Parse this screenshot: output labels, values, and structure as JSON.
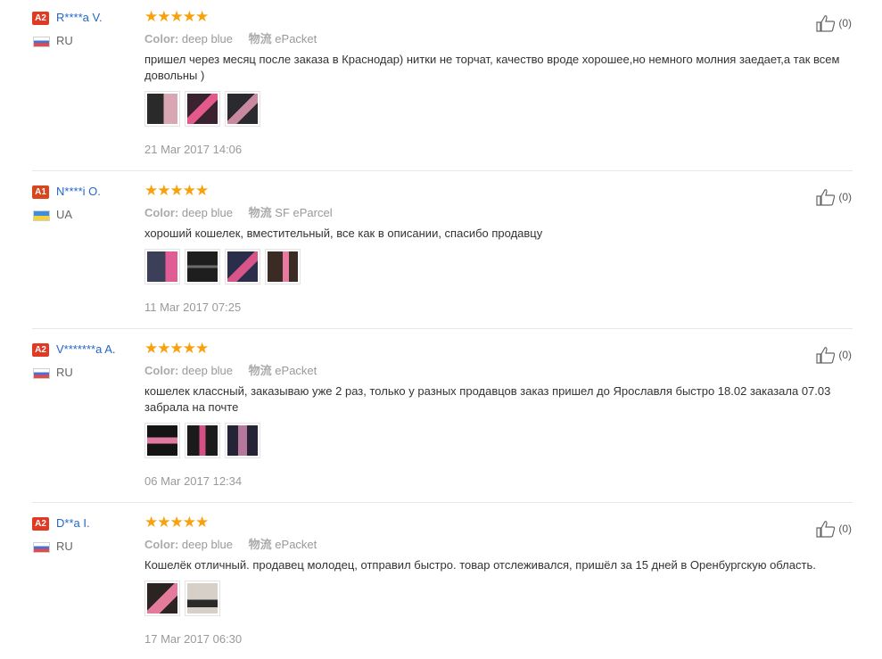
{
  "labels": {
    "color": "Color:",
    "shipping": "物流"
  },
  "reviews": [
    {
      "level": "A2",
      "level_color": "#e03a24",
      "name": "R****a V.",
      "country": "RU",
      "flag": "ru",
      "stars": "★★★★★",
      "color": "deep blue",
      "shipping": "ePacket",
      "text": "пришел через месяц после заказа в Краснодар) нитки не торчат, качество вроде хорошее,но немного молния заедает,а так всем довольны )",
      "date": "21 Mar 2017 14:06",
      "useful": "(0)",
      "photo_colors": [
        [
          "#2a2a2a",
          "#d9a6b4"
        ],
        [
          "#3a2230",
          "#e35a8a"
        ],
        [
          "#2b2a2f",
          "#c98aa0"
        ]
      ]
    },
    {
      "level": "A1",
      "level_color": "#d9451f",
      "name": "N****i O.",
      "country": "UA",
      "flag": "ua",
      "stars": "★★★★★",
      "color": "deep blue",
      "shipping": "SF eParcel",
      "text": "хороший кошелек, вместительный, все как в описании, спасибо продавцу",
      "date": "11 Mar 2017 07:25",
      "useful": "(0)",
      "photo_colors": [
        [
          "#3c3f58",
          "#e05c95"
        ],
        [
          "#1e1e1e",
          "#6b6b6b"
        ],
        [
          "#2a2e4a",
          "#d8558a"
        ],
        [
          "#3a2b25",
          "#e87aa0"
        ]
      ]
    },
    {
      "level": "A2",
      "level_color": "#e03a24",
      "name": "V*******a A.",
      "country": "RU",
      "flag": "ru",
      "stars": "★★★★★",
      "color": "deep blue",
      "shipping": "ePacket",
      "text": "кошелек классный, заказываю уже 2 раз, только у разных продавцов заказ пришел до Ярославля быстро 18.02 заказала 07.03 забрала на почте",
      "date": "06 Mar 2017 12:34",
      "useful": "(0)",
      "photo_colors": [
        [
          "#141414",
          "#e07aa0"
        ],
        [
          "#1b1b1b",
          "#d64f86"
        ],
        [
          "#242436",
          "#b5779a"
        ]
      ]
    },
    {
      "level": "A2",
      "level_color": "#e03a24",
      "name": "D**a I.",
      "country": "RU",
      "flag": "ru",
      "stars": "★★★★★",
      "color": "deep blue",
      "shipping": "ePacket",
      "text": "Кошелёк отличный. продавец молодец, отправил быстро. товар отслеживался, пришёл за 15 дней в Оренбургскую область.",
      "date": "17 Mar 2017 06:30",
      "useful": "(0)",
      "photo_colors": [
        [
          "#2c2422",
          "#e47a9c"
        ],
        [
          "#d6d0c9",
          "#2a2a2a"
        ]
      ]
    }
  ]
}
